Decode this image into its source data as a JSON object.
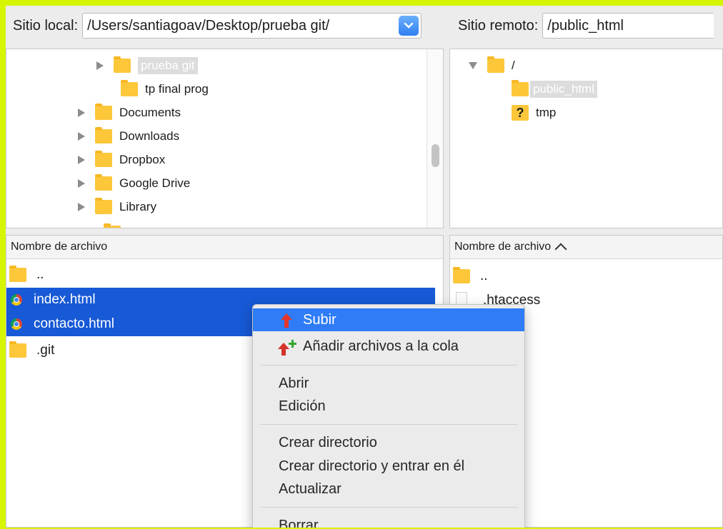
{
  "local": {
    "label": "Sitio local:",
    "path": "/Users/santiagoav/Desktop/prueba git/",
    "tree": [
      {
        "name": "prueba git",
        "expander": true,
        "selected": true
      },
      {
        "name": "tp final prog",
        "expander": false,
        "selected": false
      },
      {
        "name": "Documents",
        "expander": true,
        "selected": false
      },
      {
        "name": "Downloads",
        "expander": true,
        "selected": false
      },
      {
        "name": "Dropbox",
        "expander": true,
        "selected": false
      },
      {
        "name": "Google Drive",
        "expander": true,
        "selected": false
      },
      {
        "name": "Library",
        "expander": true,
        "selected": false
      }
    ],
    "list_header": "Nombre de archivo",
    "files": [
      {
        "name": "..",
        "icon": "folder-icon",
        "selected": false
      },
      {
        "name": "index.html",
        "icon": "chrome-icon",
        "selected": true
      },
      {
        "name": "contacto.html",
        "icon": "chrome-icon",
        "selected": true
      },
      {
        "name": ".git",
        "icon": "folder-icon",
        "selected": false
      }
    ]
  },
  "remote": {
    "label": "Sitio remoto:",
    "path": "/public_html",
    "tree": [
      {
        "name": "/",
        "icon": "folder-icon",
        "expanded": true
      },
      {
        "name": "public_html",
        "icon": "folder-icon",
        "selected": true
      },
      {
        "name": "tmp",
        "icon": "question-icon"
      }
    ],
    "list_header": "Nombre de archivo",
    "files": [
      {
        "name": "..",
        "icon": "folder-icon"
      },
      {
        "name": ".htaccess",
        "icon": "file-icon"
      }
    ]
  },
  "context_menu": {
    "items": [
      {
        "label": "Subir",
        "icon": "upload-arrow-icon",
        "active": true
      },
      {
        "label": "Añadir archivos a la cola",
        "icon": "add-to-queue-icon",
        "active": false
      },
      {
        "label": "Abrir"
      },
      {
        "label": "Edición"
      },
      {
        "label": "Crear directorio"
      },
      {
        "label": "Crear directorio y entrar en él"
      },
      {
        "label": "Actualizar"
      },
      {
        "label": "Borrar"
      }
    ]
  },
  "colors": {
    "selection": "#1759d6",
    "menu_highlight": "#2f7cf6",
    "folder": "#fdc73a",
    "frame_border": "#d6f500"
  }
}
